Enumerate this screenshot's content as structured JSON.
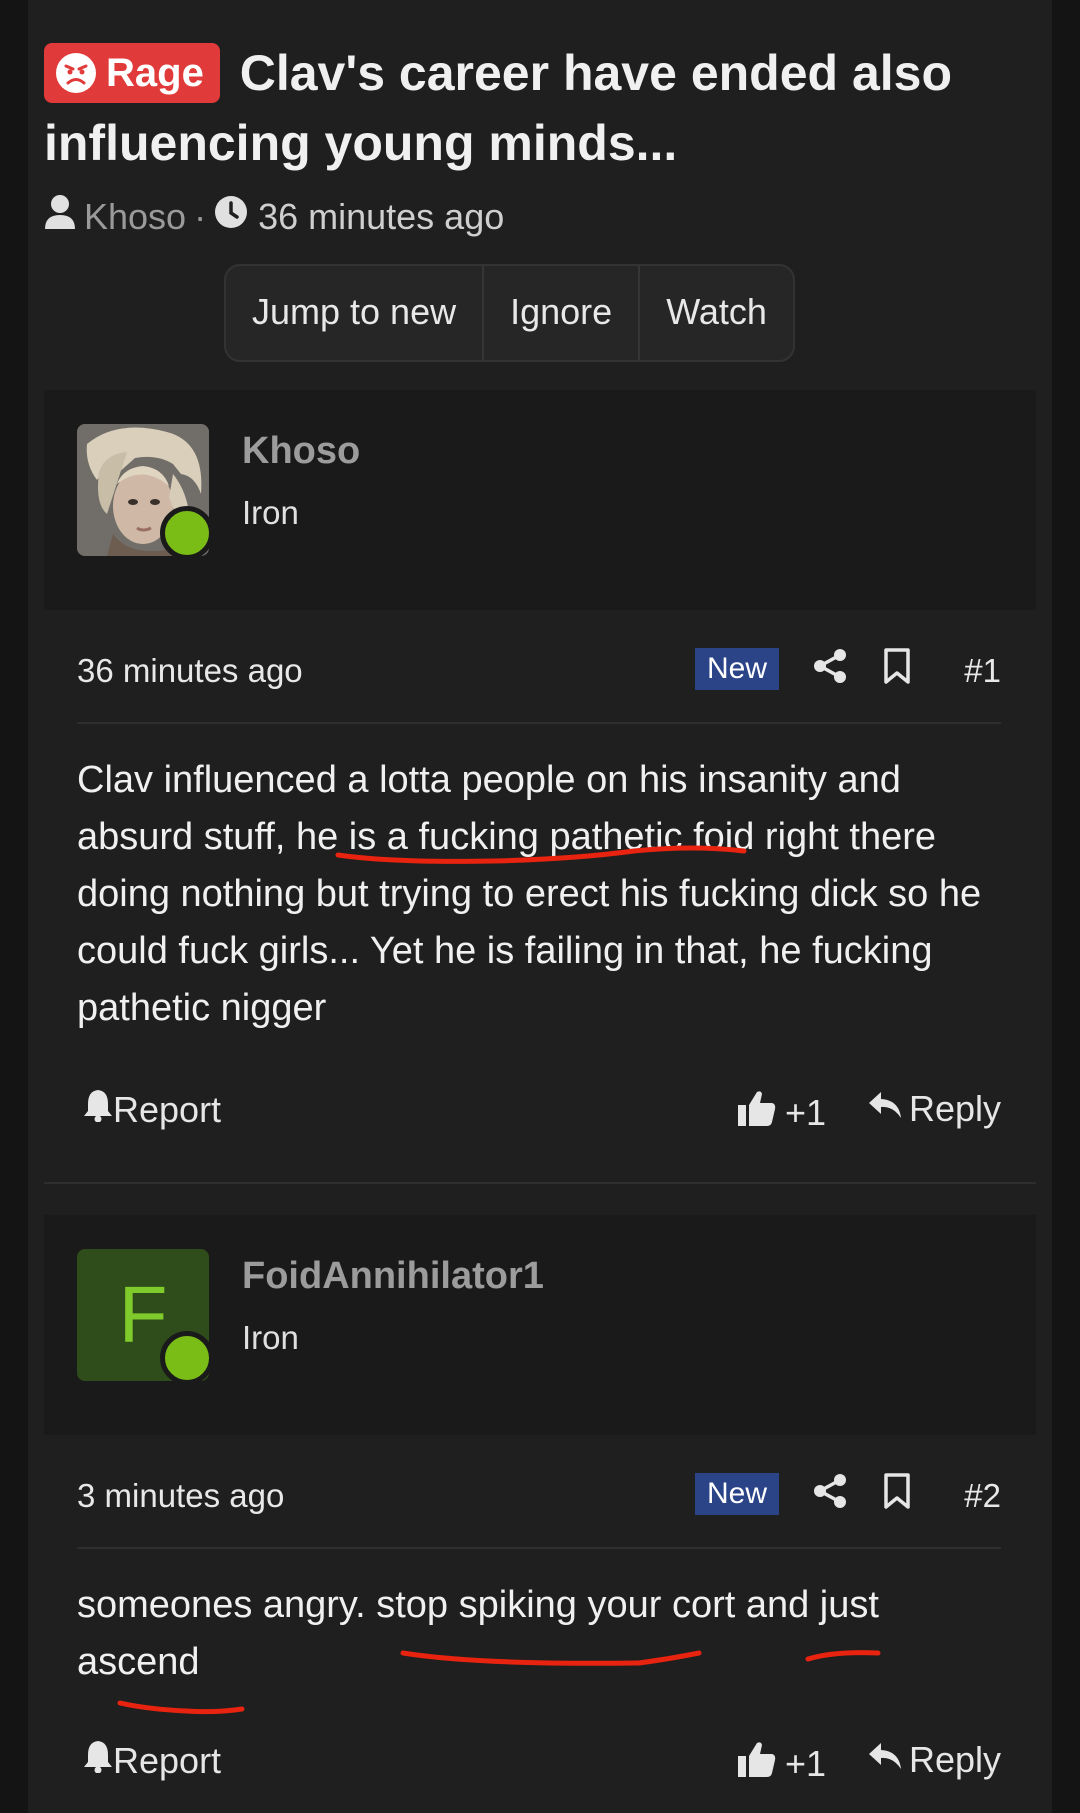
{
  "thread": {
    "prefix": "Rage",
    "title": "Clav's career have ended also influencing young minds...",
    "author": "Khoso",
    "separator": "·",
    "time": "36 minutes ago",
    "buttons": [
      "Jump to new",
      "Ignore",
      "Watch"
    ]
  },
  "posts": [
    {
      "username": "Khoso",
      "rank": "Iron",
      "time": "36 minutes ago",
      "badge": "New",
      "number": "#1",
      "body": "Clav influenced a lotta people on his insanity and absurd stuff, he is a fucking pathetic foid right there doing nothing but trying to erect his fucking dick so he could fuck girls... Yet he is failing in that, he fucking pathetic nigger",
      "report": "Report",
      "likes": "+1",
      "reply": "Reply"
    },
    {
      "username": "FoidAnnihilator1",
      "rank": "Iron",
      "avatar_letter": "F",
      "time": "3 minutes ago",
      "badge": "New",
      "number": "#2",
      "body": "someones angry. stop spiking your cort and just ascend",
      "report": "Report",
      "likes": "+1",
      "reply": "Reply"
    }
  ],
  "colors": {
    "rage_prefix": "#e03a3a",
    "new_badge": "#2b4488",
    "online_dot": "#7bbd17",
    "annotation": "#e8230f"
  },
  "icons": [
    "user-icon",
    "clock-icon",
    "share-icon",
    "bookmark-icon",
    "bell-icon",
    "thumbs-up-icon",
    "reply-icon",
    "angry-face-icon"
  ]
}
